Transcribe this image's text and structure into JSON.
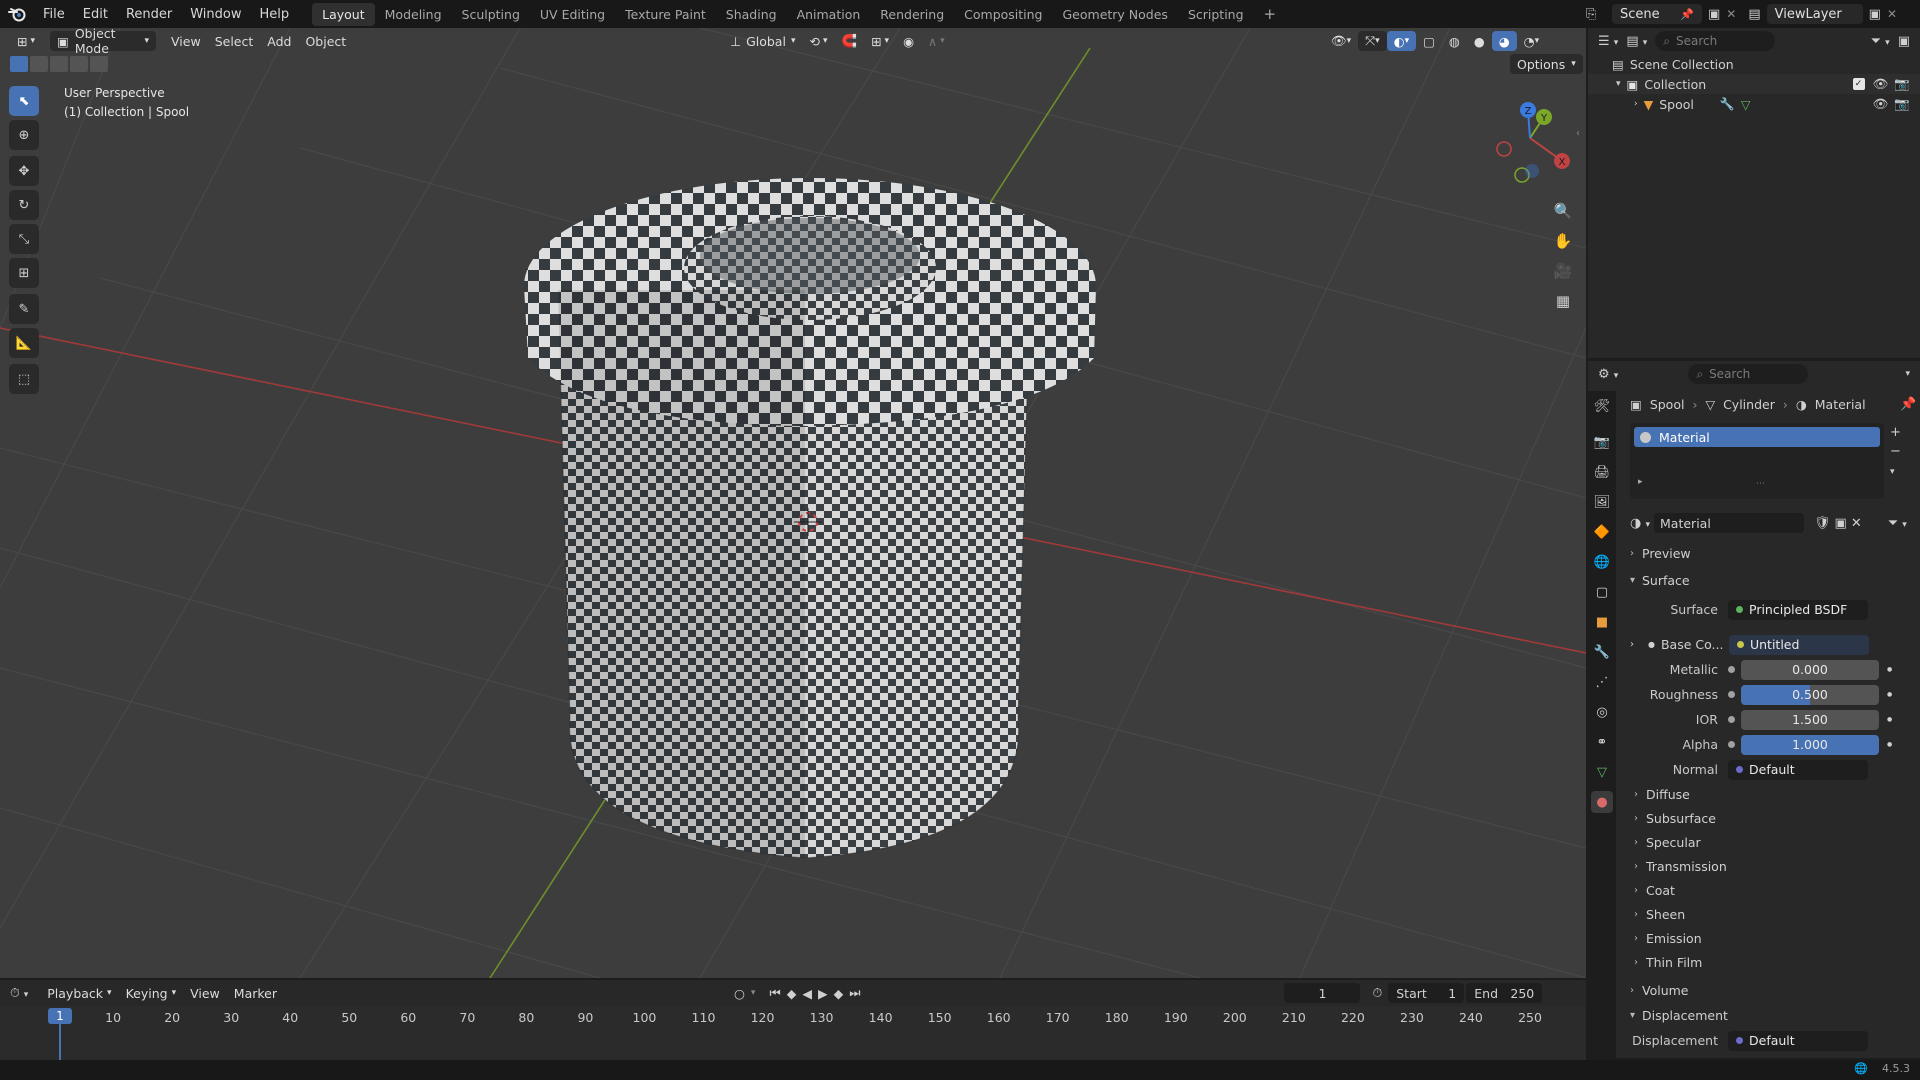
{
  "topbar": {
    "menus": [
      "File",
      "Edit",
      "Render",
      "Window",
      "Help"
    ],
    "workspaces": [
      "Layout",
      "Modeling",
      "Sculpting",
      "UV Editing",
      "Texture Paint",
      "Shading",
      "Animation",
      "Rendering",
      "Compositing",
      "Geometry Nodes",
      "Scripting"
    ],
    "active_workspace": "Layout",
    "add_tab": "+",
    "scene": "Scene",
    "view_layer": "ViewLayer"
  },
  "viewport": {
    "mode": "Object Mode",
    "menus": [
      "View",
      "Select",
      "Add",
      "Object"
    ],
    "orientation": "Global",
    "options": "Options",
    "overlay_line1": "User Perspective",
    "overlay_line2": "(1) Collection | Spool",
    "gizmo": {
      "x": "X",
      "y": "Y",
      "z": "Z"
    }
  },
  "outliner": {
    "search_placeholder": "Search",
    "scene_collection": "Scene Collection",
    "collection": "Collection",
    "object": "Spool"
  },
  "properties": {
    "search_placeholder": "Search",
    "breadcrumb": [
      "Spool",
      "Cylinder",
      "Material"
    ],
    "slot": "Material",
    "material_name": "Material",
    "panels": {
      "preview": "Preview",
      "surface": "Surface",
      "volume": "Volume",
      "displacement": "Displacement"
    },
    "surface_label": "Surface",
    "surface_value": "Principled BSDF",
    "base_color_label": "Base Co...",
    "base_color_value": "Untitled",
    "metallic_label": "Metallic",
    "metallic": "0.000",
    "roughness_label": "Roughness",
    "roughness": "0.500",
    "ior_label": "IOR",
    "ior": "1.500",
    "alpha_label": "Alpha",
    "alpha": "1.000",
    "normal_label": "Normal",
    "normal_value": "Default",
    "subpanels": [
      "Diffuse",
      "Subsurface",
      "Specular",
      "Transmission",
      "Coat",
      "Sheen",
      "Emission",
      "Thin Film"
    ],
    "displacement_label": "Displacement",
    "displacement_value": "Default"
  },
  "timeline": {
    "menus": [
      "Playback",
      "Keying",
      "View",
      "Marker"
    ],
    "current_frame": "1",
    "start_label": "Start",
    "start": "1",
    "end_label": "End",
    "end": "250",
    "ticks": [
      "1",
      "10",
      "20",
      "30",
      "40",
      "50",
      "60",
      "70",
      "80",
      "90",
      "100",
      "110",
      "120",
      "130",
      "140",
      "150",
      "160",
      "170",
      "180",
      "190",
      "200",
      "210",
      "220",
      "230",
      "240",
      "250"
    ]
  },
  "status": {
    "version": "4.5.3"
  },
  "colors": {
    "accent": "#4772b3",
    "x_axis": "#b83b3b",
    "y_axis": "#7ea42a",
    "z_axis": "#3b7be0"
  }
}
